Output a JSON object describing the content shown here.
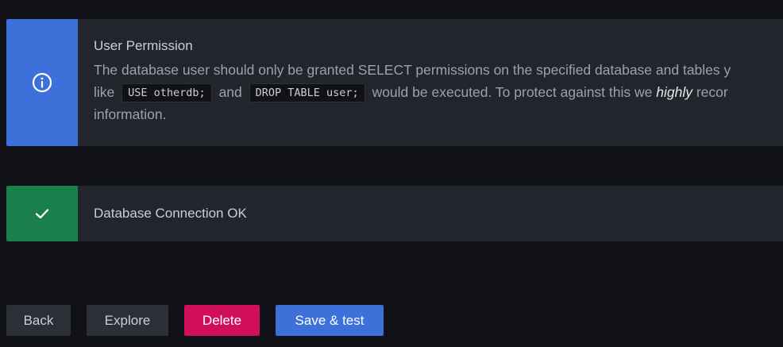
{
  "alerts": {
    "permission": {
      "icon": "info-circle-icon",
      "title": "User Permission",
      "line1": "The database user should only be granted SELECT permissions on the specified database and tables y",
      "line2_pre": "like",
      "code1": "USE otherdb;",
      "line2_mid": "and",
      "code2": "DROP TABLE user;",
      "line2_post": "would be executed. To protect against this we",
      "emphasis": "highly",
      "line2_tail": "recor",
      "line3": "information."
    },
    "connection": {
      "icon": "check-icon",
      "title": "Database Connection OK"
    }
  },
  "buttons": {
    "back": "Back",
    "explore": "Explore",
    "delete": "Delete",
    "save_test": "Save & test"
  },
  "colors": {
    "background": "#111217",
    "panel": "#22252b",
    "info_accent": "#3d71d9",
    "success_accent": "#1a7f4b",
    "delete": "#d10e5c",
    "secondary_button": "#2c2f35"
  }
}
